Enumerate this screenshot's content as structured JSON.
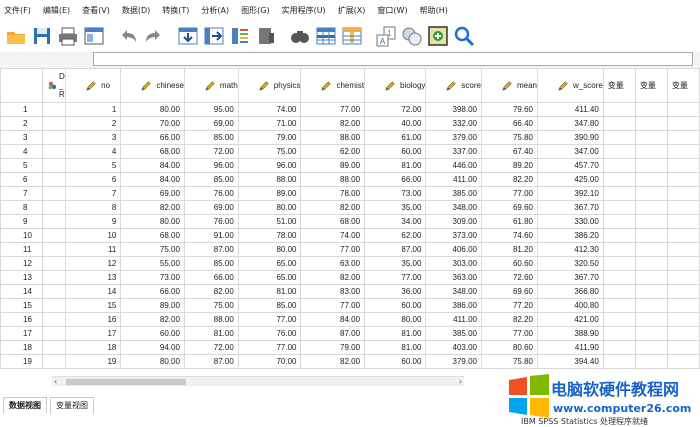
{
  "menu": [
    "文件(F)",
    "编辑(E)",
    "查看(V)",
    "数据(D)",
    "转换(T)",
    "分析(A)",
    "图形(G)",
    "实用程序(U)",
    "扩展(X)",
    "窗口(W)",
    "帮助(H)"
  ],
  "toolbar": [
    {
      "icon": "open-folder-icon"
    },
    {
      "icon": "save-icon"
    },
    {
      "icon": "print-icon"
    },
    {
      "icon": "dialog-recall-icon"
    },
    {
      "icon": "undo-icon"
    },
    {
      "icon": "redo-icon"
    },
    {
      "icon": "goto-case-icon"
    },
    {
      "icon": "goto-variable-icon"
    },
    {
      "icon": "variables-icon"
    },
    {
      "icon": "run-descriptives-icon"
    },
    {
      "icon": "find-icon"
    },
    {
      "icon": "insert-cases-icon"
    },
    {
      "icon": "insert-variable-icon"
    },
    {
      "icon": "value-labels-icon"
    },
    {
      "icon": "use-sets-icon"
    },
    {
      "icon": "spell-check-icon"
    },
    {
      "icon": "search-icon"
    }
  ],
  "columns": [
    "no",
    "chinese",
    "math",
    "physics",
    "chemist",
    "biology",
    "score",
    "mean",
    "w_score"
  ],
  "first_column_label": "D\n_\nR",
  "extra_column_label": "变量",
  "rows": [
    [
      1,
      "80.00",
      "95.00",
      "74.00",
      "77.00",
      "72.00",
      "398.00",
      "79.60",
      "411.40"
    ],
    [
      2,
      "70.00",
      "69.00",
      "71.00",
      "82.00",
      "40.00",
      "332.00",
      "66.40",
      "347.80"
    ],
    [
      3,
      "66.00",
      "85.00",
      "79.00",
      "88.00",
      "61.00",
      "379.00",
      "75.80",
      "390.90"
    ],
    [
      4,
      "68.00",
      "72.00",
      "75.00",
      "62.00",
      "60.00",
      "337.00",
      "67.40",
      "347.00"
    ],
    [
      5,
      "84.00",
      "96.00",
      "96.00",
      "89.00",
      "81.00",
      "446.00",
      "89.20",
      "457.70"
    ],
    [
      6,
      "84.00",
      "85.00",
      "88.00",
      "88.00",
      "66.00",
      "411.00",
      "82.20",
      "425.00"
    ],
    [
      7,
      "69.00",
      "76.00",
      "89.00",
      "78.00",
      "73.00",
      "385.00",
      "77.00",
      "392.10"
    ],
    [
      8,
      "82.00",
      "69.00",
      "80.00",
      "82.00",
      "35.00",
      "348.00",
      "69.60",
      "367.70"
    ],
    [
      9,
      "80.00",
      "76.00",
      "51.00",
      "68.00",
      "34.00",
      "309.00",
      "61.80",
      "330.00"
    ],
    [
      10,
      "68.00",
      "91.00",
      "78.00",
      "74.00",
      "62.00",
      "373.00",
      "74.60",
      "386.20"
    ],
    [
      11,
      "75.00",
      "87.00",
      "80.00",
      "77.00",
      "87.00",
      "406.00",
      "81.20",
      "412.30"
    ],
    [
      12,
      "55.00",
      "85.00",
      "65.00",
      "63.00",
      "35.00",
      "303.00",
      "60.60",
      "320.50"
    ],
    [
      13,
      "73.00",
      "66.00",
      "65.00",
      "82.00",
      "77.00",
      "363.00",
      "72.60",
      "367.70"
    ],
    [
      14,
      "66.00",
      "82.00",
      "81.00",
      "83.00",
      "36.00",
      "348.00",
      "69.60",
      "366.80"
    ],
    [
      15,
      "89.00",
      "75.00",
      "85.00",
      "77.00",
      "60.00",
      "386.00",
      "77.20",
      "400.80"
    ],
    [
      16,
      "82.00",
      "88.00",
      "77.00",
      "84.00",
      "80.00",
      "411.00",
      "82.20",
      "421.00"
    ],
    [
      17,
      "60.00",
      "81.00",
      "76.00",
      "87.00",
      "81.00",
      "385.00",
      "77.00",
      "388.90"
    ],
    [
      18,
      "94.00",
      "72.00",
      "77.00",
      "79.00",
      "81.00",
      "403.00",
      "80.60",
      "411.90"
    ],
    [
      19,
      "80.00",
      "87.00",
      "70.00",
      "82.00",
      "60.00",
      "379.00",
      "75.80",
      "394.40"
    ]
  ],
  "tabs": [
    {
      "label": "数据视图",
      "active": true
    },
    {
      "label": "变量视图",
      "active": false
    }
  ],
  "status": {
    "text": "IBM SPSS Statistics 处理程序就绪"
  },
  "watermark": {
    "title": "电脑软硬件教程网",
    "url": "www.computer26.com"
  },
  "colors": {
    "accent": "#1863c9",
    "grid_line": "#d9d9d9"
  }
}
